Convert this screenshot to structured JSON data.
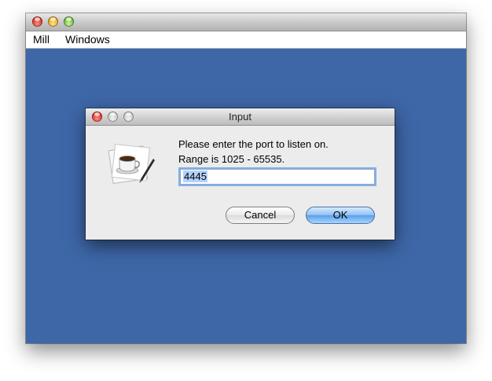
{
  "main_window": {
    "menu": [
      "Mill",
      "Windows"
    ],
    "background_color": "#3e67a8"
  },
  "dialog": {
    "title": "Input",
    "message_line1": "Please enter the port to listen on.",
    "message_line2": "Range is 1025 - 65535.",
    "port_value": "4445",
    "cancel_label": "Cancel",
    "ok_label": "OK",
    "icon": "java-coffee-cup-icon"
  }
}
